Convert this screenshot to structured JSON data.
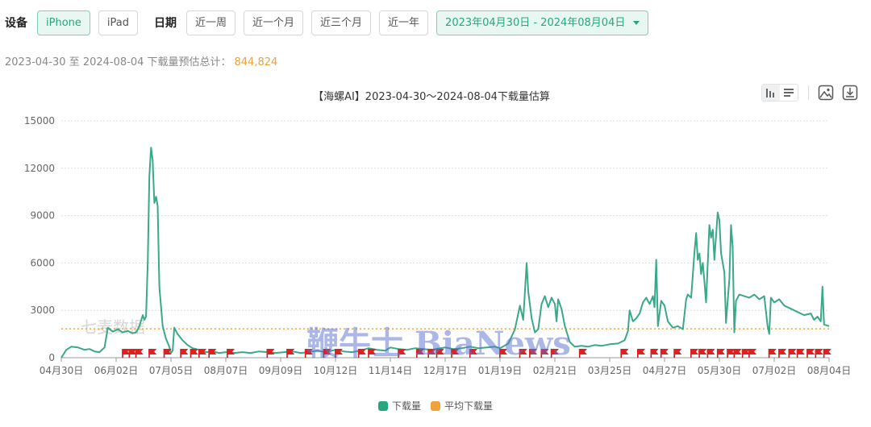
{
  "filters": {
    "device_label": "设备",
    "devices": [
      "iPhone",
      "iPad"
    ],
    "date_label": "日期",
    "quick_ranges": [
      "近一周",
      "近一个月",
      "近三个月",
      "近一年"
    ],
    "date_range": "2023年04月30日 - 2024年08月04日"
  },
  "summary": {
    "text": "2023-04-30 至 2024-08-04 下载量预估总计：",
    "total": "844,824"
  },
  "colors": {
    "accent": "#2aa57c",
    "line": "#3aa889",
    "avg": "#f0a33a",
    "flag": "#e02020"
  },
  "watermarks": {
    "qimai": "七麦数据",
    "news": "鞭牛士 BiaNews"
  },
  "chart_data": {
    "type": "line",
    "title": "【海螺AI】2023-04-30～2024-08-04下载量估算",
    "ylim": [
      0,
      15000
    ],
    "yticks": [
      0,
      3000,
      6000,
      9000,
      12000,
      15000
    ],
    "ytick_labels": [
      "0",
      "3000",
      "6000",
      "9000",
      "12000",
      "15000"
    ],
    "x_start": "2023-04-30",
    "x_end": "2024-08-04",
    "xtick_labels": [
      "04月30日",
      "06月02日",
      "07月05日",
      "08月07日",
      "09月09日",
      "10月12日",
      "11月14日",
      "12月17日",
      "01月19日",
      "02月21日",
      "03月25日",
      "04月27日",
      "05月30日",
      "07月02日",
      "08月04日"
    ],
    "series": [
      {
        "name": "下载量",
        "points": [
          [
            "2023-04-30",
            0
          ],
          [
            "2023-05-03",
            500
          ],
          [
            "2023-05-06",
            700
          ],
          [
            "2023-05-10",
            650
          ],
          [
            "2023-05-14",
            500
          ],
          [
            "2023-05-17",
            550
          ],
          [
            "2023-05-20",
            400
          ],
          [
            "2023-05-23",
            350
          ],
          [
            "2023-05-26",
            650
          ],
          [
            "2023-05-28",
            1900
          ],
          [
            "2023-05-31",
            1650
          ],
          [
            "2023-06-03",
            1800
          ],
          [
            "2023-06-06",
            1600
          ],
          [
            "2023-06-09",
            1700
          ],
          [
            "2023-06-12",
            1550
          ],
          [
            "2023-06-14",
            1600
          ],
          [
            "2023-06-16",
            2000
          ],
          [
            "2023-06-18",
            2700
          ],
          [
            "2023-06-19",
            2400
          ],
          [
            "2023-06-20",
            2600
          ],
          [
            "2023-06-21",
            6000
          ],
          [
            "2023-06-22",
            11500
          ],
          [
            "2023-06-23",
            13300
          ],
          [
            "2023-06-24",
            12500
          ],
          [
            "2023-06-25",
            9800
          ],
          [
            "2023-06-26",
            10200
          ],
          [
            "2023-06-27",
            9600
          ],
          [
            "2023-06-28",
            4500
          ],
          [
            "2023-06-30",
            2000
          ],
          [
            "2023-07-02",
            1200
          ],
          [
            "2023-07-04",
            700
          ],
          [
            "2023-07-05",
            300
          ],
          [
            "2023-07-06",
            450
          ],
          [
            "2023-07-07",
            1900
          ],
          [
            "2023-07-09",
            1500
          ],
          [
            "2023-07-12",
            1100
          ],
          [
            "2023-07-15",
            800
          ],
          [
            "2023-07-18",
            600
          ],
          [
            "2023-07-22",
            500
          ],
          [
            "2023-07-26",
            350
          ],
          [
            "2023-07-30",
            400
          ],
          [
            "2023-08-03",
            300
          ],
          [
            "2023-08-07",
            350
          ],
          [
            "2023-08-12",
            300
          ],
          [
            "2023-08-17",
            350
          ],
          [
            "2023-08-22",
            300
          ],
          [
            "2023-08-27",
            400
          ],
          [
            "2023-09-01",
            350
          ],
          [
            "2023-09-06",
            300
          ],
          [
            "2023-09-11",
            350
          ],
          [
            "2023-09-16",
            400
          ],
          [
            "2023-09-21",
            300
          ],
          [
            "2023-09-26",
            350
          ],
          [
            "2023-10-01",
            450
          ],
          [
            "2023-10-06",
            350
          ],
          [
            "2023-10-12",
            500
          ],
          [
            "2023-10-17",
            400
          ],
          [
            "2023-10-22",
            350
          ],
          [
            "2023-10-27",
            450
          ],
          [
            "2023-11-01",
            600
          ],
          [
            "2023-11-06",
            500
          ],
          [
            "2023-11-11",
            450
          ],
          [
            "2023-11-14",
            650
          ],
          [
            "2023-11-19",
            550
          ],
          [
            "2023-11-24",
            500
          ],
          [
            "2023-11-29",
            600
          ],
          [
            "2023-12-04",
            550
          ],
          [
            "2023-12-09",
            500
          ],
          [
            "2023-12-14",
            600
          ],
          [
            "2023-12-17",
            650
          ],
          [
            "2023-12-22",
            550
          ],
          [
            "2023-12-27",
            600
          ],
          [
            "2024-01-01",
            700
          ],
          [
            "2024-01-06",
            600
          ],
          [
            "2024-01-11",
            650
          ],
          [
            "2024-01-16",
            700
          ],
          [
            "2024-01-19",
            600
          ],
          [
            "2024-01-24",
            900
          ],
          [
            "2024-01-28",
            1800
          ],
          [
            "2024-01-31",
            3300
          ],
          [
            "2024-02-02",
            2400
          ],
          [
            "2024-02-04",
            6000
          ],
          [
            "2024-02-05",
            4200
          ],
          [
            "2024-02-07",
            2500
          ],
          [
            "2024-02-09",
            1600
          ],
          [
            "2024-02-11",
            1800
          ],
          [
            "2024-02-13",
            3400
          ],
          [
            "2024-02-15",
            3900
          ],
          [
            "2024-02-17",
            3200
          ],
          [
            "2024-02-19",
            3800
          ],
          [
            "2024-02-21",
            3400
          ],
          [
            "2024-02-22",
            2300
          ],
          [
            "2024-02-23",
            3700
          ],
          [
            "2024-02-25",
            3100
          ],
          [
            "2024-02-27",
            2000
          ],
          [
            "2024-03-01",
            1000
          ],
          [
            "2024-03-04",
            700
          ],
          [
            "2024-03-08",
            750
          ],
          [
            "2024-03-12",
            700
          ],
          [
            "2024-03-16",
            800
          ],
          [
            "2024-03-20",
            750
          ],
          [
            "2024-03-25",
            850
          ],
          [
            "2024-03-30",
            900
          ],
          [
            "2024-04-03",
            1100
          ],
          [
            "2024-04-05",
            1700
          ],
          [
            "2024-04-06",
            3000
          ],
          [
            "2024-04-08",
            2300
          ],
          [
            "2024-04-10",
            2500
          ],
          [
            "2024-04-12",
            2800
          ],
          [
            "2024-04-14",
            3500
          ],
          [
            "2024-04-16",
            3800
          ],
          [
            "2024-04-18",
            3400
          ],
          [
            "2024-04-20",
            3900
          ],
          [
            "2024-04-21",
            3200
          ],
          [
            "2024-04-22",
            6200
          ],
          [
            "2024-04-23",
            2000
          ],
          [
            "2024-04-25",
            3600
          ],
          [
            "2024-04-27",
            3300
          ],
          [
            "2024-04-29",
            2300
          ],
          [
            "2024-05-02",
            1900
          ],
          [
            "2024-05-05",
            2000
          ],
          [
            "2024-05-08",
            1800
          ],
          [
            "2024-05-10",
            3700
          ],
          [
            "2024-05-11",
            4000
          ],
          [
            "2024-05-13",
            3800
          ],
          [
            "2024-05-15",
            6700
          ],
          [
            "2024-05-16",
            7900
          ],
          [
            "2024-05-17",
            6200
          ],
          [
            "2024-05-18",
            6600
          ],
          [
            "2024-05-19",
            5300
          ],
          [
            "2024-05-20",
            6000
          ],
          [
            "2024-05-21",
            4800
          ],
          [
            "2024-05-22",
            3500
          ],
          [
            "2024-05-24",
            8400
          ],
          [
            "2024-05-25",
            7600
          ],
          [
            "2024-05-26",
            8100
          ],
          [
            "2024-05-27",
            6200
          ],
          [
            "2024-05-29",
            9200
          ],
          [
            "2024-05-30",
            8700
          ],
          [
            "2024-05-31",
            6600
          ],
          [
            "2024-06-02",
            5400
          ],
          [
            "2024-06-03",
            2200
          ],
          [
            "2024-06-05",
            5000
          ],
          [
            "2024-06-06",
            8400
          ],
          [
            "2024-06-07",
            7000
          ],
          [
            "2024-06-08",
            1600
          ],
          [
            "2024-06-09",
            3600
          ],
          [
            "2024-06-11",
            4000
          ],
          [
            "2024-06-14",
            3900
          ],
          [
            "2024-06-17",
            3800
          ],
          [
            "2024-06-20",
            4000
          ],
          [
            "2024-06-23",
            3700
          ],
          [
            "2024-06-26",
            3900
          ],
          [
            "2024-06-28",
            2000
          ],
          [
            "2024-06-29",
            1500
          ],
          [
            "2024-06-30",
            3800
          ],
          [
            "2024-07-02",
            3500
          ],
          [
            "2024-07-05",
            3700
          ],
          [
            "2024-07-08",
            3300
          ],
          [
            "2024-07-12",
            3100
          ],
          [
            "2024-07-16",
            2900
          ],
          [
            "2024-07-20",
            2700
          ],
          [
            "2024-07-24",
            2800
          ],
          [
            "2024-07-26",
            2400
          ],
          [
            "2024-07-28",
            2600
          ],
          [
            "2024-07-30",
            2300
          ],
          [
            "2024-07-31",
            4500
          ],
          [
            "2024-08-01",
            2100
          ],
          [
            "2024-08-04",
            2000
          ]
        ]
      },
      {
        "name": "平均下载量",
        "value": 1830
      }
    ],
    "flags": [
      "2023-06-06",
      "2023-06-10",
      "2023-06-14",
      "2023-06-22",
      "2023-07-01",
      "2023-07-11",
      "2023-07-17",
      "2023-07-22",
      "2023-07-28",
      "2023-08-08",
      "2023-09-01",
      "2023-09-13",
      "2023-09-24",
      "2023-10-05",
      "2023-10-12",
      "2023-10-26",
      "2023-11-01",
      "2023-11-19",
      "2023-11-30",
      "2023-12-07",
      "2023-12-12",
      "2023-12-21",
      "2024-01-01",
      "2024-01-19",
      "2024-01-31",
      "2024-02-06",
      "2024-02-13",
      "2024-02-19",
      "2024-03-07",
      "2024-04-01",
      "2024-04-11",
      "2024-04-19",
      "2024-04-25",
      "2024-05-03",
      "2024-05-13",
      "2024-05-18",
      "2024-05-23",
      "2024-05-29",
      "2024-06-04",
      "2024-06-08",
      "2024-06-13",
      "2024-06-17",
      "2024-06-29",
      "2024-07-05",
      "2024-07-11",
      "2024-07-16",
      "2024-07-22",
      "2024-07-27",
      "2024-08-01"
    ]
  }
}
